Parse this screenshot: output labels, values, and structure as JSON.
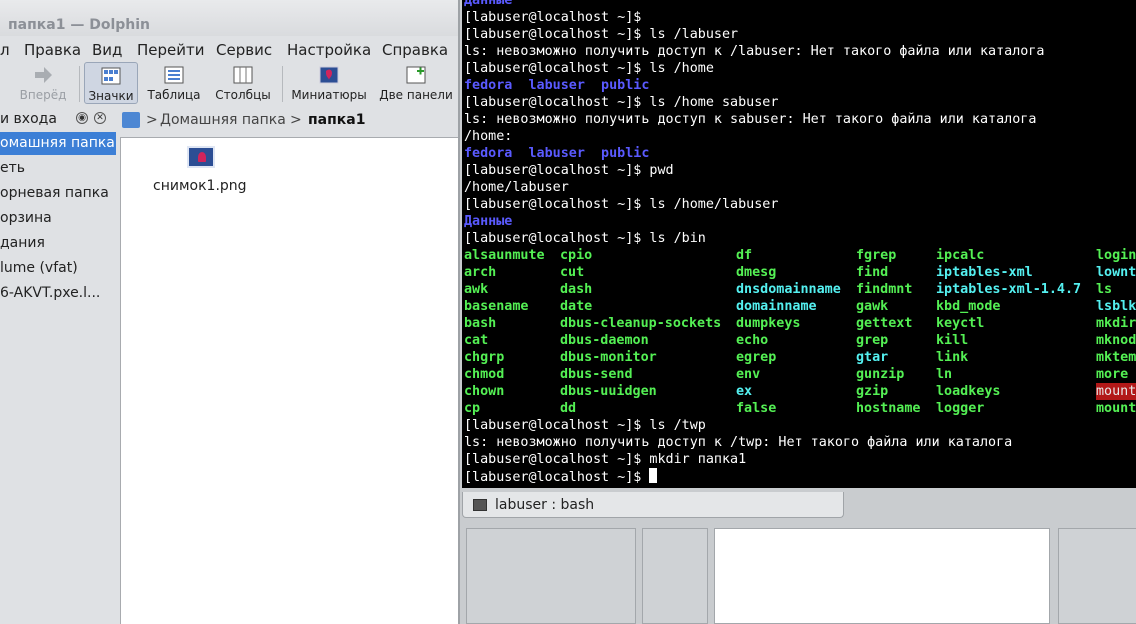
{
  "dolphin": {
    "title": "папка1 — Dolphin",
    "menu": [
      "л",
      "Правка",
      "Вид",
      "Перейти",
      "Сервис",
      "Настройка",
      "Справка"
    ],
    "toolbar": {
      "forward": "Вперёд",
      "icons": "Значки",
      "table": "Таблица",
      "columns": "Столбцы",
      "thumbnails": "Миниатюры",
      "split": "Две панели"
    },
    "places": {
      "header": "и входа",
      "items": [
        "омашняя папка",
        "еть",
        "орневая папка",
        "орзина",
        "дания",
        "lume (vfat)",
        "6-AKVT.pxe.l..."
      ]
    },
    "breadcrumb": {
      "home": "Домашняя папка",
      "sep": ">",
      "current": "папка1"
    },
    "files": [
      {
        "name": "снимок1.png",
        "icon": "image-file-icon"
      }
    ]
  },
  "terminal": {
    "tab_label": "labuser : bash",
    "lines": [
      {
        "text": "Данные",
        "style": "blue"
      },
      {
        "text": "[labuser@localhost ~]$"
      },
      {
        "text": "[labuser@localhost ~]$ ls /labuser"
      },
      {
        "text": "ls: невозможно получить доступ к /labuser: Нет такого файла или каталога"
      },
      {
        "text": "[labuser@localhost ~]$ ls /home"
      },
      {
        "text": "fedora  labuser  public",
        "style": "blue"
      },
      {
        "text": "[labuser@localhost ~]$ ls /home sabuser"
      },
      {
        "text": "ls: невозможно получить доступ к sabuser: Нет такого файла или каталога"
      },
      {
        "text": "/home:"
      },
      {
        "text": "fedora  labuser  public",
        "style": "blue"
      },
      {
        "text": "[labuser@localhost ~]$ pwd"
      },
      {
        "text": "/home/labuser"
      },
      {
        "text": "[labuser@localhost ~]$ ls /home/labuser"
      },
      {
        "text": "Данные",
        "style": "blue"
      },
      {
        "text": "[labuser@localhost ~]$ ls /bin"
      }
    ],
    "bin_columns": [
      [
        "alsaunmute",
        "arch",
        "awk",
        "basename",
        "bash",
        "cat",
        "chgrp",
        "chmod",
        "chown",
        "cp"
      ],
      [
        "cpio",
        "cut",
        "dash",
        "date",
        "dbus-cleanup-sockets",
        "dbus-daemon",
        "dbus-monitor",
        "dbus-send",
        "dbus-uuidgen",
        "dd"
      ],
      [
        "df",
        "dmesg",
        "dnsdomainname",
        "domainname",
        "dumpkeys",
        "echo",
        "egrep",
        "env",
        "ex",
        "false"
      ],
      [
        "fgrep",
        "find",
        "findmnt",
        "gawk",
        "gettext",
        "grep",
        "gtar",
        "gunzip",
        "gzip",
        "hostname"
      ],
      [
        "ipcalc",
        "iptables-xml",
        "iptables-xml-1.4.7",
        "kbd_mode",
        "keyctl",
        "kill",
        "link",
        "ln",
        "loadkeys",
        "logger"
      ],
      [
        "login",
        "lowntf",
        "ls",
        "lsblk",
        "mkdir",
        "mknod",
        "mktemp",
        "more",
        "mount",
        "mountp"
      ]
    ],
    "bin_cyan": [
      "dnsdomainname",
      "domainname",
      "gtar",
      "iptables-xml",
      "iptables-xml-1.4.7",
      "ex",
      "lowntf",
      "lsblk"
    ],
    "bin_red": [
      "mount"
    ],
    "tail_lines": [
      {
        "text": "[labuser@localhost ~]$ ls /twp"
      },
      {
        "text": "ls: невозможно получить доступ к /twp: Нет такого файла или каталога"
      },
      {
        "text": "[labuser@localhost ~]$ mkdir папка1"
      },
      {
        "text": "[labuser@localhost ~]$ "
      }
    ]
  }
}
